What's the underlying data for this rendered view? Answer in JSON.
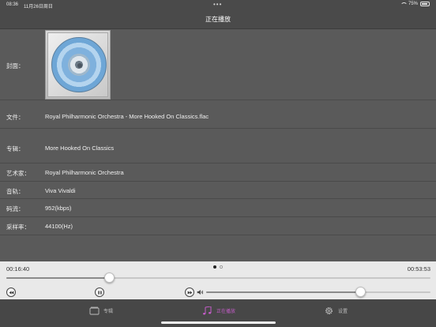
{
  "status_bar": {
    "time": "08:36",
    "date": "11月26日周日",
    "battery": "75%"
  },
  "nav": {
    "title": "正在播放"
  },
  "details": {
    "cover_label": "封面：",
    "file_label": "文件：",
    "file_value": "Royal Philharmonic Orchestra - More Hooked On Classics.flac",
    "album_label": "专辑：",
    "album_value": "More Hooked On Classics",
    "artist_label": "艺术家：",
    "artist_value": "Royal Philharmonic Orchestra",
    "track_label": "音轨：",
    "track_value": "Viva Vivaldi",
    "bitrate_label": "码流：",
    "bitrate_value": "952(kbps)",
    "samplerate_label": "采样率：",
    "samplerate_value": "44100(Hz)"
  },
  "player": {
    "elapsed": "00:16:40",
    "total": "00:53:53",
    "progress_fraction": 0.243,
    "volume_fraction": 0.69,
    "page_count": 2,
    "current_page": 0
  },
  "tabs": [
    {
      "label": "专辑",
      "icon": "album-icon",
      "active": false
    },
    {
      "label": "正在播放",
      "icon": "music-note-icon",
      "active": true
    },
    {
      "label": "设置",
      "icon": "gear-icon",
      "active": false
    }
  ],
  "colors": {
    "accent": "#c45cc8",
    "background": "#5a5a5a",
    "bar": "#4a4a4a"
  }
}
